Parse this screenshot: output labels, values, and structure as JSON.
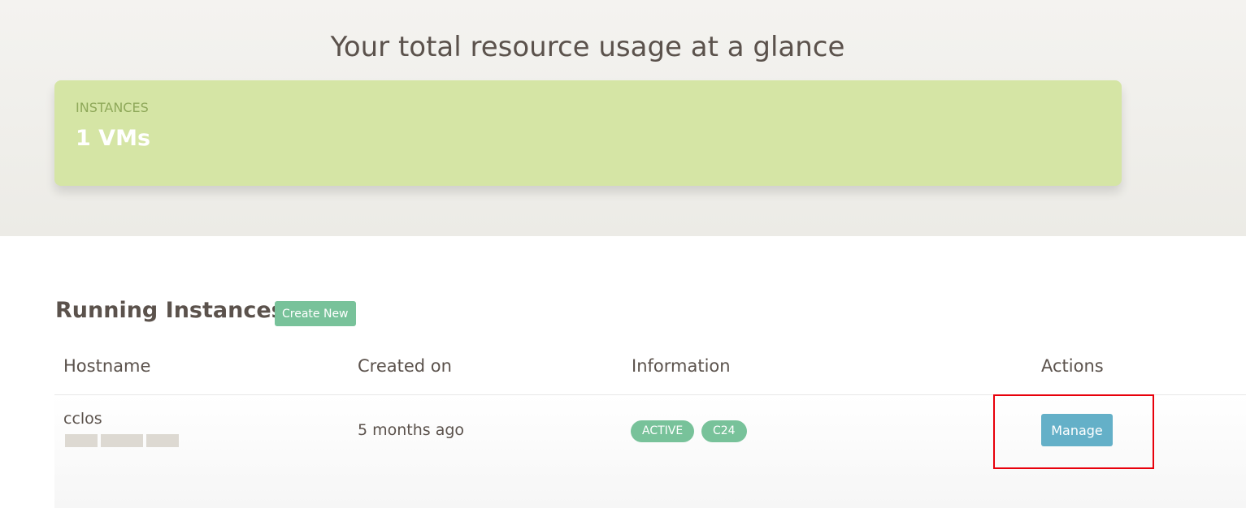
{
  "header": {
    "title": "Your total resource usage at a glance"
  },
  "summary": {
    "label": "INSTANCES",
    "value": "1 VMs",
    "color": "#d5e5a5"
  },
  "instances": {
    "title": "Running Instances",
    "create_label": "Create New",
    "columns": [
      "Hostname",
      "Created on",
      "Information",
      "Actions"
    ],
    "rows": [
      {
        "hostname": "cclos",
        "created": "5 months ago",
        "status": "ACTIVE",
        "plan": "C24",
        "action": "Manage"
      }
    ]
  }
}
